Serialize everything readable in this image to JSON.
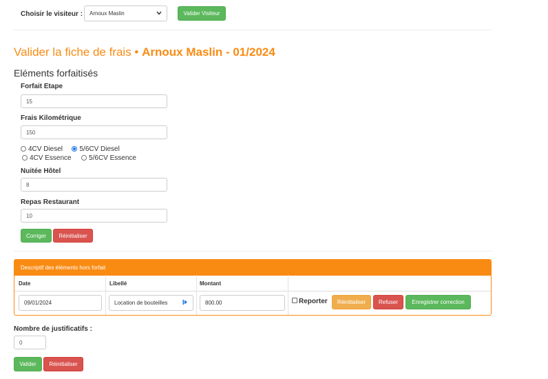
{
  "visitor_select": {
    "label": "Choisir le visiteur :",
    "value": "Arnoux Maslin",
    "submit_label": "Valider Visiteur"
  },
  "page_title": {
    "prefix": "Valider la fiche de frais •",
    "highlight": "Arnoux Maslin - 01/2024"
  },
  "forfait": {
    "heading": "Eléments forfaitisés",
    "etape": {
      "label": "Forfait Etape",
      "value": "15"
    },
    "km": {
      "label": "Frais Kilométrique",
      "value": "150"
    },
    "vehicle_options": [
      {
        "label": "4CV Diesel",
        "checked": false
      },
      {
        "label": "5/6CV Diesel",
        "checked": true
      },
      {
        "label": "4CV Essence",
        "checked": false
      },
      {
        "label": "5/6CV Essence",
        "checked": false
      }
    ],
    "nuitee": {
      "label": "Nuitée Hôtel",
      "value": "8"
    },
    "repas": {
      "label": "Repas Restaurant",
      "value": "10"
    },
    "correct_label": "Corriger",
    "reset_label": "Réinitialiser"
  },
  "hors_forfait": {
    "header": "Descriptif des éléments hors forfait",
    "columns": [
      "Date",
      "Libellé",
      "Montant"
    ],
    "row": {
      "date": "09/01/2024",
      "libelle": "Location de bouteilles",
      "montant": "800.00",
      "reporter_label": "Reporter",
      "reset_label": "Réinitialiser",
      "refuse_label": "Refuser",
      "save_label": "Enregistrer correction"
    }
  },
  "justificatifs": {
    "label": "Nombre de justificatifs :",
    "value": "0"
  },
  "footer": {
    "validate_label": "Valider",
    "reset_label": "Réinitialiser"
  },
  "colors": {
    "accent": "#f98b13",
    "green": "#5cb85c",
    "red": "#d9534f",
    "orange": "#f0ad4e"
  }
}
